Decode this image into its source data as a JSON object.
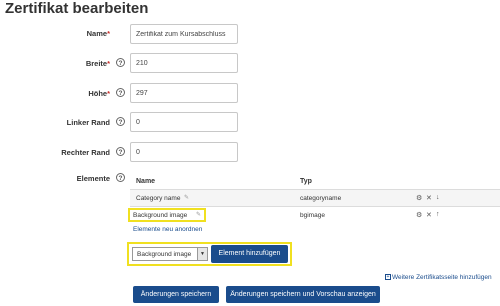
{
  "page": {
    "title": "Zertifikat bearbeiten"
  },
  "form": {
    "name": {
      "label": "Name",
      "value": "Zertifikat zum Kursabschluss"
    },
    "width": {
      "label": "Breite",
      "value": "210"
    },
    "height": {
      "label": "Höhe",
      "value": "297"
    },
    "left_margin": {
      "label": "Linker Rand",
      "value": "0"
    },
    "right_margin": {
      "label": "Rechter Rand",
      "value": "0"
    },
    "elements_label": "Elemente",
    "required_marker": "*"
  },
  "elements_table": {
    "columns": [
      "Name",
      "Typ"
    ],
    "rows": [
      {
        "name": "Category name",
        "type": "categoryname"
      },
      {
        "name": "Background image",
        "type": "bgimage"
      }
    ],
    "reorder_link": "Elemente neu anordnen"
  },
  "add_element": {
    "select_value": "Background image",
    "button_label": "Element hinzufügen"
  },
  "add_page_link": "Weitere Zertifikatsseite hinzufügen",
  "footer": {
    "save_label": "Änderungen speichern",
    "save_preview_label": "Änderungen speichern und Vorschau anzeigen"
  },
  "colors": {
    "primary": "#1a4c8c",
    "highlight": "#f0e020",
    "required": "#c9302c"
  },
  "icons": {
    "help": "question-circle-icon",
    "edit": "pencil-icon",
    "settings": "gear-icon",
    "delete": "close-icon",
    "move_down": "arrow-down-icon",
    "move_up": "arrow-up-icon",
    "add_page": "add-page-icon"
  }
}
